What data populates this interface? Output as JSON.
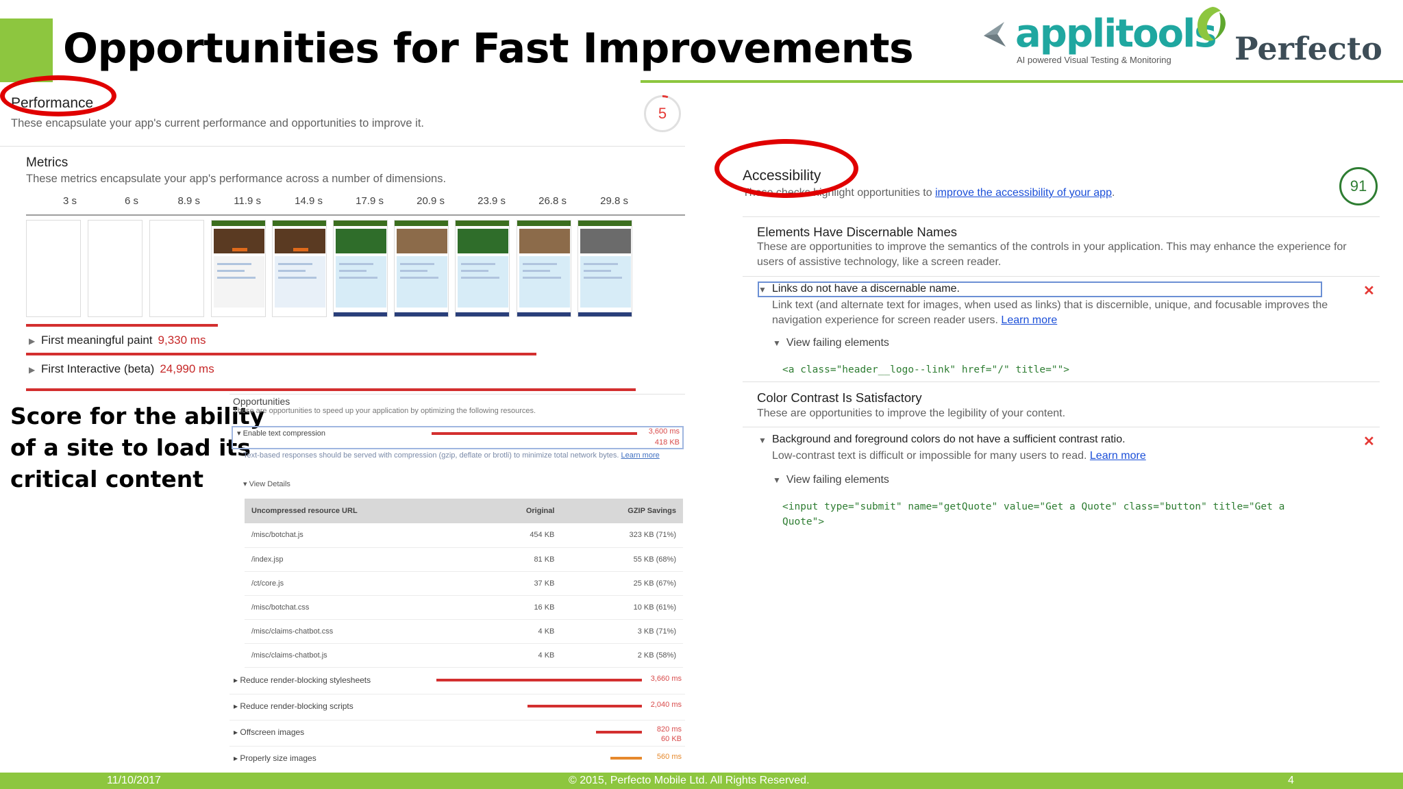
{
  "slide": {
    "title": "Opportunities for Fast Improvements",
    "caption": [
      "Score for the ability",
      "of a site to load its",
      "critical content"
    ]
  },
  "logos": {
    "applitools": "applitools",
    "applitools_tagline": "AI powered Visual Testing & Monitoring",
    "perfecto": "Perfecto"
  },
  "footer": {
    "date": "11/10/2017",
    "copyright": "© 2015, Perfecto Mobile Ltd.  All Rights Reserved.",
    "page": "4"
  },
  "colors": {
    "accent_green": "#8dc63f",
    "annotation_red": "#e00000",
    "fail_red": "#e53935",
    "pass_green": "#2e7d32",
    "link_blue": "#1a4ed8"
  },
  "performance": {
    "title": "Performance",
    "description": "These encapsulate your app's current performance and opportunities to improve it.",
    "score": "5",
    "metrics_title": "Metrics",
    "metrics_description": "These metrics encapsulate your app's performance across a number of dimensions.",
    "filmstrip_times": [
      "3 s",
      "6 s",
      "8.9 s",
      "11.9 s",
      "14.9 s",
      "17.9 s",
      "20.9 s",
      "23.9 s",
      "26.8 s",
      "29.8 s"
    ],
    "metrics": [
      {
        "name": "First meaningful paint",
        "value": "9,330 ms"
      },
      {
        "name": "First Interactive (beta)",
        "value": "24,990 ms"
      }
    ]
  },
  "opportunities": {
    "title": "Opportunities",
    "description": "These are opportunities to speed up your application by optimizing the following resources.",
    "enable_text_compression": {
      "label": "Enable text compression",
      "ms": "3,600 ms",
      "kb": "418 KB"
    },
    "note": "Text-based responses should be served with compression (gzip, deflate or brotli) to minimize total network bytes.",
    "note_link": "Learn more",
    "view_details": "View Details",
    "table": {
      "headers": [
        "Uncompressed resource URL",
        "Original",
        "GZIP Savings"
      ],
      "rows": [
        [
          "/misc/botchat.js",
          "454 KB",
          "323 KB (71%)"
        ],
        [
          "/index.jsp",
          "81 KB",
          "55 KB (68%)"
        ],
        [
          "/ct/core.js",
          "37 KB",
          "25 KB (67%)"
        ],
        [
          "/misc/botchat.css",
          "16 KB",
          "10 KB (61%)"
        ],
        [
          "/misc/claims-chatbot.css",
          "4 KB",
          "3 KB (71%)"
        ],
        [
          "/misc/claims-chatbot.js",
          "4 KB",
          "2 KB (58%)"
        ]
      ]
    },
    "more": [
      {
        "label": "Reduce render-blocking stylesheets",
        "ms": "3,660 ms"
      },
      {
        "label": "Reduce render-blocking scripts",
        "ms": "2,040 ms"
      },
      {
        "label": "Offscreen images",
        "ms": "820 ms",
        "kb": "60 KB"
      },
      {
        "label": "Properly size images",
        "ms": "560 ms"
      }
    ]
  },
  "accessibility": {
    "title": "Accessibility",
    "description_prefix": "These checks highlight opportunities to ",
    "description_link": "improve the accessibility of your app",
    "description_suffix": ".",
    "score": "91",
    "sections": [
      {
        "title": "Elements Have Discernable Names",
        "description": "These are opportunities to improve the semantics of the controls in your application. This may enhance the experience for users of assistive technology, like a screen reader.",
        "audit": "Links do not have a discernable name.",
        "audit_description": "Link text (and alternate text for images, when used as links) that is discernible, unique, and focusable improves the navigation experience for screen reader users.",
        "learn_more": "Learn more",
        "view_failing": "View failing elements",
        "code": "<a class=\"header__logo--link\" href=\"/\" title=\"\">"
      },
      {
        "title": "Color Contrast Is Satisfactory",
        "description": "These are opportunities to improve the legibility of your content.",
        "audit": "Background and foreground colors do not have a sufficient contrast ratio.",
        "audit_description": "Low-contrast text is difficult or impossible for many users to read.",
        "learn_more": "Learn more",
        "view_failing": "View failing elements",
        "code": "<input type=\"submit\" name=\"getQuote\" value=\"Get a Quote\" class=\"button\" title=\"Get a Quote\">"
      }
    ]
  },
  "icons": [
    "applitools-logo-icon",
    "perfecto-logo-icon",
    "fail-x-icon",
    "disclosure-triangle-icon"
  ]
}
